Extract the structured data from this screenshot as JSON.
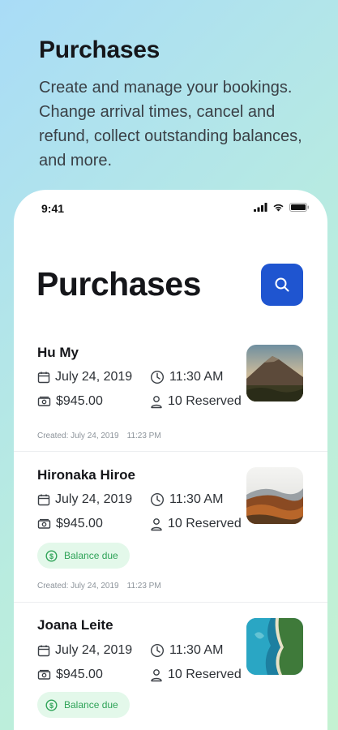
{
  "promo": {
    "title": "Purchases",
    "description": "Create and manage your bookings. Change arrival times, cancel and refund, collect outstanding balances, and more."
  },
  "status_bar": {
    "time": "9:41"
  },
  "header": {
    "title": "Purchases"
  },
  "purchases": [
    {
      "name": "Hu My",
      "date": "July 24, 2019",
      "time": "11:30 AM",
      "amount": "$945.00",
      "reserved": "10 Reserved",
      "created_label": "Created: July 24, 2019",
      "created_time": "11:23 PM",
      "badge": "",
      "thumb": "mountain-photo"
    },
    {
      "name": "Hironaka Hiroe",
      "date": "July 24, 2019",
      "time": "11:30 AM",
      "amount": "$945.00",
      "reserved": "10 Reserved",
      "created_label": "Created: July 24, 2019",
      "created_time": "11:23 PM",
      "badge": "Balance due",
      "thumb": "autumn-forest-photo"
    },
    {
      "name": "Joana Leite",
      "date": "July 24, 2019",
      "time": "11:30 AM",
      "amount": "$945.00",
      "reserved": "10 Reserved",
      "created_label": "",
      "created_time": "",
      "badge": "Balance due",
      "thumb": "coastline-photo"
    }
  ],
  "colors": {
    "accent": "#1f55d0",
    "badge_bg": "#e3f8ea",
    "badge_text": "#2fa358"
  }
}
